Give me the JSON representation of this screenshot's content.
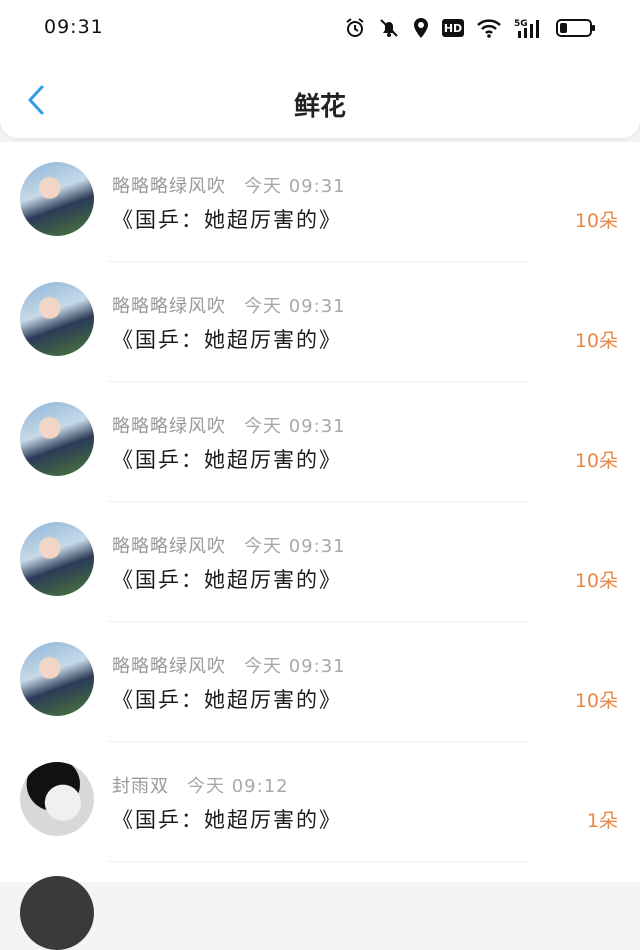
{
  "status_bar": {
    "time": "09:31",
    "network": "5G",
    "hd": "HD"
  },
  "header": {
    "title": "鲜花"
  },
  "gifts": [
    {
      "sender": "略略略绿风吹",
      "time": "今天 09:31",
      "message": "《国乒：她超厉害的》",
      "amount": "10朵",
      "avatar": "girl"
    },
    {
      "sender": "略略略绿风吹",
      "time": "今天 09:31",
      "message": "《国乒：她超厉害的》",
      "amount": "10朵",
      "avatar": "girl"
    },
    {
      "sender": "略略略绿风吹",
      "time": "今天 09:31",
      "message": "《国乒：她超厉害的》",
      "amount": "10朵",
      "avatar": "girl"
    },
    {
      "sender": "略略略绿风吹",
      "time": "今天 09:31",
      "message": "《国乒：她超厉害的》",
      "amount": "10朵",
      "avatar": "girl"
    },
    {
      "sender": "略略略绿风吹",
      "time": "今天 09:31",
      "message": "《国乒：她超厉害的》",
      "amount": "10朵",
      "avatar": "girl"
    },
    {
      "sender": "封雨双",
      "time": "今天 09:12",
      "message": "《国乒：她超厉害的》",
      "amount": "1朵",
      "avatar": "boy"
    }
  ],
  "colors": {
    "accent": "#2f9be6",
    "amount": "#e8894a"
  }
}
